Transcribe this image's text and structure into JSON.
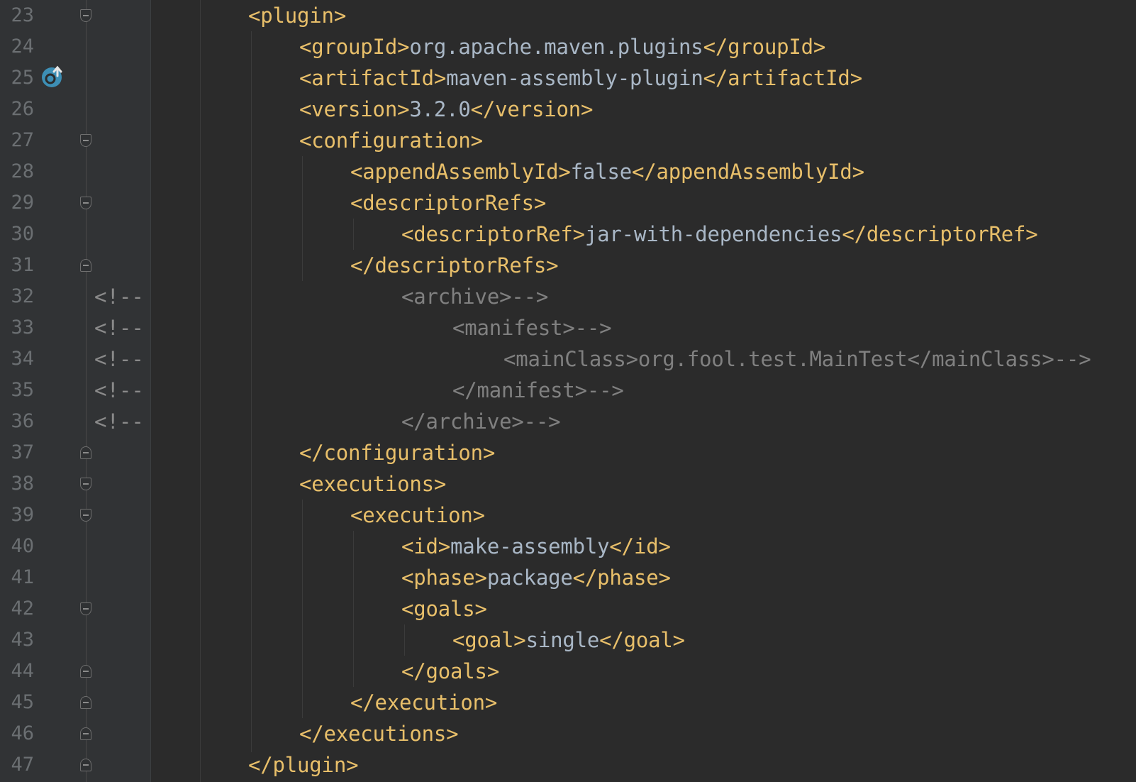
{
  "editor": {
    "lines": [
      {
        "num": "23",
        "indent": 0,
        "marker": "",
        "fold": "open",
        "tokens": [
          {
            "t": "tag",
            "v": "<plugin>"
          }
        ]
      },
      {
        "num": "24",
        "indent": 1,
        "marker": "",
        "fold": "",
        "tokens": [
          {
            "t": "tag",
            "v": "<groupId>"
          },
          {
            "t": "txt",
            "v": "org.apache.maven.plugins"
          },
          {
            "t": "tag",
            "v": "</groupId>"
          }
        ]
      },
      {
        "num": "25",
        "indent": 1,
        "marker": "",
        "fold": "",
        "tokens": [
          {
            "t": "tag",
            "v": "<artifactId>"
          },
          {
            "t": "txt",
            "v": "maven-assembly-plugin"
          },
          {
            "t": "tag",
            "v": "</artifactId>"
          }
        ]
      },
      {
        "num": "26",
        "indent": 1,
        "marker": "",
        "fold": "",
        "tokens": [
          {
            "t": "tag",
            "v": "<version>"
          },
          {
            "t": "txt",
            "v": "3.2.0"
          },
          {
            "t": "tag",
            "v": "</version>"
          }
        ]
      },
      {
        "num": "27",
        "indent": 1,
        "marker": "",
        "fold": "open",
        "tokens": [
          {
            "t": "tag",
            "v": "<configuration>"
          }
        ]
      },
      {
        "num": "28",
        "indent": 2,
        "marker": "",
        "fold": "",
        "tokens": [
          {
            "t": "tag",
            "v": "<appendAssemblyId>"
          },
          {
            "t": "txt",
            "v": "false"
          },
          {
            "t": "tag",
            "v": "</appendAssemblyId>"
          }
        ]
      },
      {
        "num": "29",
        "indent": 2,
        "marker": "",
        "fold": "open",
        "tokens": [
          {
            "t": "tag",
            "v": "<descriptorRefs>"
          }
        ]
      },
      {
        "num": "30",
        "indent": 3,
        "marker": "",
        "fold": "",
        "tokens": [
          {
            "t": "tag",
            "v": "<descriptorRef>"
          },
          {
            "t": "txt",
            "v": "jar-with-dependencies"
          },
          {
            "t": "tag",
            "v": "</descriptorRef>"
          }
        ]
      },
      {
        "num": "31",
        "indent": 2,
        "marker": "",
        "fold": "close",
        "tokens": [
          {
            "t": "tag",
            "v": "</descriptorRefs>"
          }
        ]
      },
      {
        "num": "32",
        "indent": 3,
        "marker": "<!--",
        "fold": "",
        "tokens": [
          {
            "t": "com",
            "v": "<archive>-->"
          }
        ]
      },
      {
        "num": "33",
        "indent": 4,
        "marker": "<!--",
        "fold": "",
        "tokens": [
          {
            "t": "com",
            "v": "<manifest>-->"
          }
        ]
      },
      {
        "num": "34",
        "indent": 5,
        "marker": "<!--",
        "fold": "",
        "tokens": [
          {
            "t": "com",
            "v": "<mainClass>org.fool.test.MainTest</mainClass>-->"
          }
        ]
      },
      {
        "num": "35",
        "indent": 4,
        "marker": "<!--",
        "fold": "",
        "tokens": [
          {
            "t": "com",
            "v": "</manifest>-->"
          }
        ]
      },
      {
        "num": "36",
        "indent": 3,
        "marker": "<!--",
        "fold": "",
        "tokens": [
          {
            "t": "com",
            "v": "</archive>-->"
          }
        ]
      },
      {
        "num": "37",
        "indent": 1,
        "marker": "",
        "fold": "close",
        "tokens": [
          {
            "t": "tag",
            "v": "</configuration>"
          }
        ]
      },
      {
        "num": "38",
        "indent": 1,
        "marker": "",
        "fold": "open",
        "tokens": [
          {
            "t": "tag",
            "v": "<executions>"
          }
        ]
      },
      {
        "num": "39",
        "indent": 2,
        "marker": "",
        "fold": "open",
        "tokens": [
          {
            "t": "tag",
            "v": "<execution>"
          }
        ]
      },
      {
        "num": "40",
        "indent": 3,
        "marker": "",
        "fold": "",
        "tokens": [
          {
            "t": "tag",
            "v": "<id>"
          },
          {
            "t": "txt",
            "v": "make-assembly"
          },
          {
            "t": "tag",
            "v": "</id>"
          }
        ]
      },
      {
        "num": "41",
        "indent": 3,
        "marker": "",
        "fold": "",
        "tokens": [
          {
            "t": "tag",
            "v": "<phase>"
          },
          {
            "t": "txt",
            "v": "package"
          },
          {
            "t": "tag",
            "v": "</phase>"
          }
        ]
      },
      {
        "num": "42",
        "indent": 3,
        "marker": "",
        "fold": "open",
        "tokens": [
          {
            "t": "tag",
            "v": "<goals>"
          }
        ]
      },
      {
        "num": "43",
        "indent": 4,
        "marker": "",
        "fold": "",
        "tokens": [
          {
            "t": "tag",
            "v": "<goal>"
          },
          {
            "t": "txt",
            "v": "single"
          },
          {
            "t": "tag",
            "v": "</goal>"
          }
        ]
      },
      {
        "num": "44",
        "indent": 3,
        "marker": "",
        "fold": "close",
        "tokens": [
          {
            "t": "tag",
            "v": "</goals>"
          }
        ]
      },
      {
        "num": "45",
        "indent": 2,
        "marker": "",
        "fold": "close",
        "tokens": [
          {
            "t": "tag",
            "v": "</execution>"
          }
        ]
      },
      {
        "num": "46",
        "indent": 1,
        "marker": "",
        "fold": "close",
        "tokens": [
          {
            "t": "tag",
            "v": "</executions>"
          }
        ]
      },
      {
        "num": "47",
        "indent": 0,
        "marker": "",
        "fold": "close",
        "tokens": [
          {
            "t": "tag",
            "v": "</plugin>"
          }
        ]
      }
    ],
    "gutter_icon": "override-icon",
    "colors": {
      "background": "#2b2b2b",
      "tag": "#e8bf6a",
      "text": "#a9b7c6",
      "comment": "#808080",
      "line_number": "#6b6f72"
    }
  }
}
